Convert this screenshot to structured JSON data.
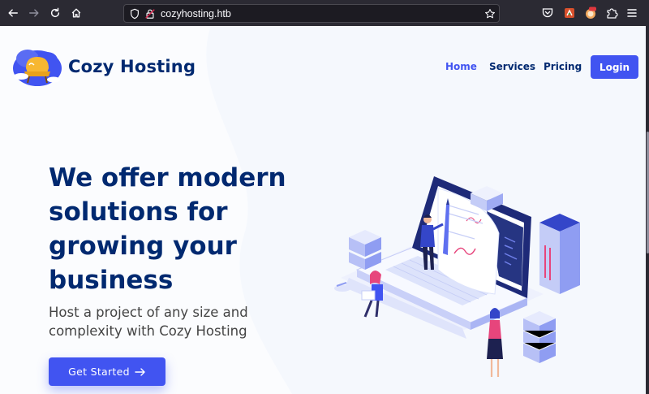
{
  "browser": {
    "url": "cozyhosting.htb"
  },
  "site": {
    "brand": "Cozy Hosting",
    "nav": [
      {
        "label": "Home",
        "active": true
      },
      {
        "label": "Services",
        "active": false
      },
      {
        "label": "Pricing",
        "active": false
      }
    ],
    "login_label": "Login"
  },
  "hero": {
    "title": "We offer modern solutions for growing your business",
    "subtitle": "Host a project of any size and complexity with Cozy Hosting",
    "cta_label": "Get Started",
    "cta_icon": "arrow-right-icon"
  },
  "colors": {
    "accent": "#4154f1",
    "heading": "#012970",
    "text": "#444444",
    "background": "#f5f8fd"
  }
}
